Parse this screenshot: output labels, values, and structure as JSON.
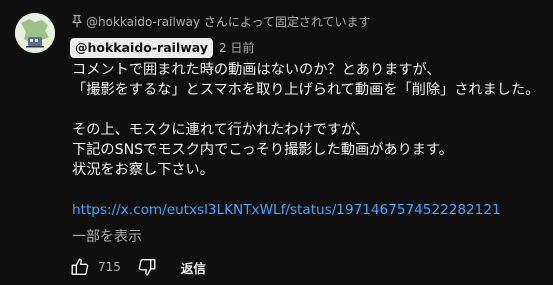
{
  "pinned": {
    "icon": "pin-icon",
    "text": "@hokkaido-railway さんによって固定されています"
  },
  "author": {
    "handle": "@hokkaido-railway",
    "time": "2 日前"
  },
  "comment": {
    "lines": [
      "コメントで囲まれた時の動画はないのか？とありますが、",
      "「撮影をするな」とスマホを取り上げられて動画を「削除」されました。",
      "",
      "その上、モスクに連れて行かれたわけですが、",
      "下記のSNSでモスク内でこっそり撮影した動画があります。",
      "状況をお察し下さい。",
      ""
    ],
    "link": "https://x.com/eutxsl3LKNTxWLf/status/1971467574522282121",
    "read_more": "一部を表示"
  },
  "actions": {
    "like_icon": "thumb-up-icon",
    "like_count": "715",
    "dislike_icon": "thumb-down-icon",
    "reply_label": "返信"
  },
  "colors": {
    "background": "#0f0f0f",
    "text": "#f1f1f1",
    "secondary": "#aaaaaa",
    "link": "#3ea6ff",
    "chip": "#ececec"
  }
}
